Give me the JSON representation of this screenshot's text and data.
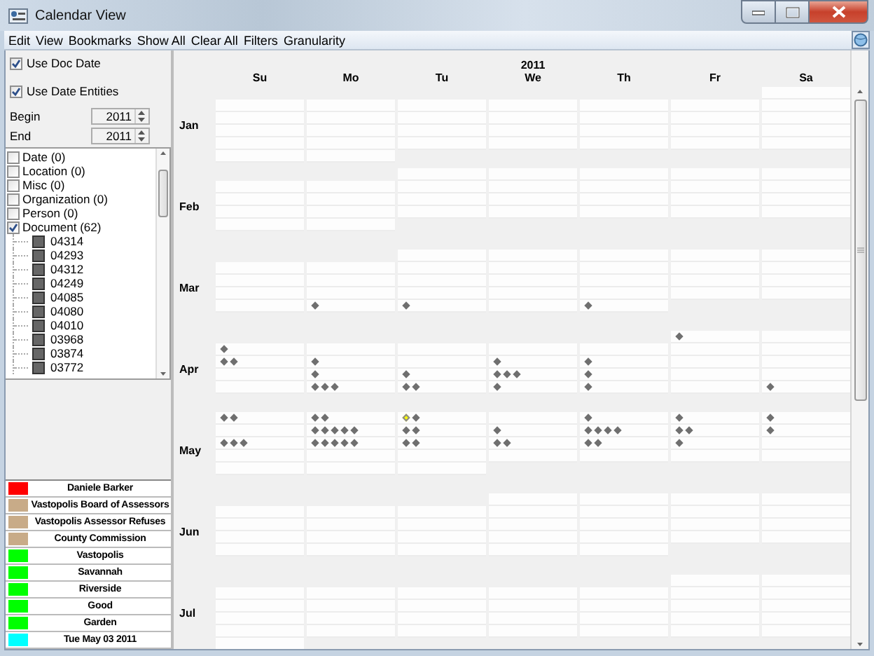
{
  "window": {
    "title": "Calendar View"
  },
  "menu": [
    "Edit",
    "View",
    "Bookmarks",
    "Show All",
    "Clear All",
    "Filters",
    "Granularity"
  ],
  "options": [
    {
      "label": "Use Doc Date",
      "checked": true
    },
    {
      "label": "Use Date Entities",
      "checked": true
    }
  ],
  "range": [
    {
      "label": "Begin",
      "value": "2011"
    },
    {
      "label": "End",
      "value": "2011"
    }
  ],
  "entity_tree": [
    {
      "label": "Date (0)",
      "checked": false
    },
    {
      "label": "Location (0)",
      "checked": false
    },
    {
      "label": "Misc (0)",
      "checked": false
    },
    {
      "label": "Organization (0)",
      "checked": false
    },
    {
      "label": "Person (0)",
      "checked": false
    },
    {
      "label": "Document (62)",
      "checked": true,
      "children": [
        {
          "label": "04314"
        },
        {
          "label": "04293"
        },
        {
          "label": "04312"
        },
        {
          "label": "04249"
        },
        {
          "label": "04085"
        },
        {
          "label": "04080"
        },
        {
          "label": "04010"
        },
        {
          "label": "03968"
        },
        {
          "label": "03874"
        },
        {
          "label": "03772"
        }
      ]
    }
  ],
  "legend": [
    {
      "label": "Daniele Barker",
      "color": "#ff0000"
    },
    {
      "label": "Vastopolis Board of Assessors",
      "color": "#c8ab88"
    },
    {
      "label": "Vastopolis Assessor Refuses",
      "color": "#c8ab88"
    },
    {
      "label": "County Commission",
      "color": "#c8ab88"
    },
    {
      "label": "Vastopolis",
      "color": "#00ff00"
    },
    {
      "label": "Savannah",
      "color": "#00ff00"
    },
    {
      "label": "Riverside",
      "color": "#00ff00"
    },
    {
      "label": "Good",
      "color": "#00ff00"
    },
    {
      "label": "Garden",
      "color": "#00ff00"
    },
    {
      "label": "Tue May 03 2011",
      "color": "#00ffff"
    }
  ],
  "calendar": {
    "year": "2011",
    "weekdays": [
      "Su",
      "Mo",
      "Tu",
      "We",
      "Th",
      "Fr",
      "Sa"
    ],
    "months": [
      {
        "label": "Jan",
        "weeks": [
          [
            {
              "kind": "blank"
            },
            {
              "kind": "blank"
            },
            {
              "kind": "blank"
            },
            {
              "kind": "blank"
            },
            {
              "kind": "blank"
            },
            {
              "kind": "blank"
            },
            {
              "kind": "day"
            }
          ],
          [
            {
              "kind": "day"
            },
            {
              "kind": "day"
            },
            {
              "kind": "day"
            },
            {
              "kind": "day"
            },
            {
              "kind": "day"
            },
            {
              "kind": "day"
            },
            {
              "kind": "day"
            }
          ],
          [
            {
              "kind": "day"
            },
            {
              "kind": "day"
            },
            {
              "kind": "day"
            },
            {
              "kind": "day"
            },
            {
              "kind": "day"
            },
            {
              "kind": "day"
            },
            {
              "kind": "day"
            }
          ],
          [
            {
              "kind": "day"
            },
            {
              "kind": "day"
            },
            {
              "kind": "day"
            },
            {
              "kind": "day"
            },
            {
              "kind": "day"
            },
            {
              "kind": "day"
            },
            {
              "kind": "day"
            }
          ],
          [
            {
              "kind": "day"
            },
            {
              "kind": "day"
            },
            {
              "kind": "day"
            },
            {
              "kind": "day"
            },
            {
              "kind": "day"
            },
            {
              "kind": "day"
            },
            {
              "kind": "day"
            }
          ],
          [
            {
              "kind": "day"
            },
            {
              "kind": "day"
            },
            {
              "kind": "blank"
            },
            {
              "kind": "blank"
            },
            {
              "kind": "blank"
            },
            {
              "kind": "blank"
            },
            {
              "kind": "blank"
            }
          ]
        ]
      },
      {
        "label": "Feb",
        "weeks": [
          [
            {
              "kind": "blank"
            },
            {
              "kind": "blank"
            },
            {
              "kind": "day"
            },
            {
              "kind": "day"
            },
            {
              "kind": "day"
            },
            {
              "kind": "day"
            },
            {
              "kind": "day"
            }
          ],
          [
            {
              "kind": "day"
            },
            {
              "kind": "day"
            },
            {
              "kind": "day"
            },
            {
              "kind": "day"
            },
            {
              "kind": "day"
            },
            {
              "kind": "day"
            },
            {
              "kind": "day"
            }
          ],
          [
            {
              "kind": "day"
            },
            {
              "kind": "day"
            },
            {
              "kind": "day"
            },
            {
              "kind": "day"
            },
            {
              "kind": "day"
            },
            {
              "kind": "day"
            },
            {
              "kind": "day"
            }
          ],
          [
            {
              "kind": "day"
            },
            {
              "kind": "day"
            },
            {
              "kind": "day"
            },
            {
              "kind": "day"
            },
            {
              "kind": "day"
            },
            {
              "kind": "day"
            },
            {
              "kind": "day"
            }
          ],
          [
            {
              "kind": "day"
            },
            {
              "kind": "day"
            },
            {
              "kind": "blank"
            },
            {
              "kind": "blank"
            },
            {
              "kind": "blank"
            },
            {
              "kind": "blank"
            },
            {
              "kind": "blank"
            }
          ]
        ]
      },
      {
        "label": "Mar",
        "weeks": [
          [
            {
              "kind": "blank"
            },
            {
              "kind": "blank"
            },
            {
              "kind": "day"
            },
            {
              "kind": "day"
            },
            {
              "kind": "day"
            },
            {
              "kind": "day"
            },
            {
              "kind": "day"
            }
          ],
          [
            {
              "kind": "day"
            },
            {
              "kind": "day"
            },
            {
              "kind": "day"
            },
            {
              "kind": "day"
            },
            {
              "kind": "day"
            },
            {
              "kind": "day"
            },
            {
              "kind": "day"
            }
          ],
          [
            {
              "kind": "day"
            },
            {
              "kind": "day"
            },
            {
              "kind": "day"
            },
            {
              "kind": "day"
            },
            {
              "kind": "day"
            },
            {
              "kind": "day"
            },
            {
              "kind": "day"
            }
          ],
          [
            {
              "kind": "day"
            },
            {
              "kind": "day"
            },
            {
              "kind": "day"
            },
            {
              "kind": "day"
            },
            {
              "kind": "day"
            },
            {
              "kind": "day"
            },
            {
              "kind": "day"
            }
          ],
          [
            {
              "kind": "day"
            },
            {
              "kind": "day",
              "events": [
                {
                  "selected": false
                }
              ]
            },
            {
              "kind": "day",
              "events": [
                {
                  "selected": false
                }
              ]
            },
            {
              "kind": "day"
            },
            {
              "kind": "day",
              "events": [
                {
                  "selected": false
                }
              ]
            },
            {
              "kind": "blank"
            },
            {
              "kind": "blank"
            }
          ]
        ]
      },
      {
        "label": "Apr",
        "weeks": [
          [
            {
              "kind": "blank"
            },
            {
              "kind": "blank"
            },
            {
              "kind": "blank"
            },
            {
              "kind": "blank"
            },
            {
              "kind": "blank"
            },
            {
              "kind": "day",
              "events": [
                {
                  "selected": false
                }
              ]
            },
            {
              "kind": "day"
            }
          ],
          [
            {
              "kind": "day",
              "events": [
                {
                  "selected": false
                }
              ]
            },
            {
              "kind": "day"
            },
            {
              "kind": "day"
            },
            {
              "kind": "day"
            },
            {
              "kind": "day"
            },
            {
              "kind": "day"
            },
            {
              "kind": "day"
            }
          ],
          [
            {
              "kind": "day",
              "events": [
                {
                  "selected": false
                },
                {
                  "selected": false
                }
              ]
            },
            {
              "kind": "day",
              "events": [
                {
                  "selected": false
                }
              ]
            },
            {
              "kind": "day"
            },
            {
              "kind": "day",
              "events": [
                {
                  "selected": false
                }
              ]
            },
            {
              "kind": "day",
              "events": [
                {
                  "selected": false
                }
              ]
            },
            {
              "kind": "day"
            },
            {
              "kind": "day"
            }
          ],
          [
            {
              "kind": "day"
            },
            {
              "kind": "day",
              "events": [
                {
                  "selected": false
                }
              ]
            },
            {
              "kind": "day",
              "events": [
                {
                  "selected": false
                }
              ]
            },
            {
              "kind": "day",
              "events": [
                {
                  "selected": false
                },
                {
                  "selected": false
                },
                {
                  "selected": false
                }
              ]
            },
            {
              "kind": "day",
              "events": [
                {
                  "selected": false
                }
              ]
            },
            {
              "kind": "day"
            },
            {
              "kind": "day"
            }
          ],
          [
            {
              "kind": "day"
            },
            {
              "kind": "day",
              "events": [
                {
                  "selected": false
                },
                {
                  "selected": false
                },
                {
                  "selected": false
                }
              ]
            },
            {
              "kind": "day",
              "events": [
                {
                  "selected": false
                },
                {
                  "selected": false
                }
              ]
            },
            {
              "kind": "day",
              "events": [
                {
                  "selected": false
                }
              ]
            },
            {
              "kind": "day",
              "events": [
                {
                  "selected": false
                }
              ]
            },
            {
              "kind": "day"
            },
            {
              "kind": "day",
              "events": [
                {
                  "selected": false
                }
              ]
            }
          ]
        ]
      },
      {
        "label": "May",
        "weeks": [
          [
            {
              "kind": "day",
              "events": [
                {
                  "selected": false
                },
                {
                  "selected": false
                }
              ]
            },
            {
              "kind": "day",
              "events": [
                {
                  "selected": false
                },
                {
                  "selected": false
                }
              ]
            },
            {
              "kind": "day",
              "events": [
                {
                  "selected": true
                },
                {
                  "selected": false
                }
              ]
            },
            {
              "kind": "day"
            },
            {
              "kind": "day",
              "events": [
                {
                  "selected": false
                }
              ]
            },
            {
              "kind": "day",
              "events": [
                {
                  "selected": false
                }
              ]
            },
            {
              "kind": "day",
              "events": [
                {
                  "selected": false
                }
              ]
            }
          ],
          [
            {
              "kind": "day"
            },
            {
              "kind": "day",
              "events": [
                {
                  "selected": false
                },
                {
                  "selected": false
                },
                {
                  "selected": false
                },
                {
                  "selected": false
                },
                {
                  "selected": false
                }
              ]
            },
            {
              "kind": "day",
              "events": [
                {
                  "selected": false
                },
                {
                  "selected": false
                }
              ]
            },
            {
              "kind": "day",
              "events": [
                {
                  "selected": false
                }
              ]
            },
            {
              "kind": "day",
              "events": [
                {
                  "selected": false
                },
                {
                  "selected": false
                },
                {
                  "selected": false
                },
                {
                  "selected": false
                }
              ]
            },
            {
              "kind": "day",
              "events": [
                {
                  "selected": false
                },
                {
                  "selected": false
                }
              ]
            },
            {
              "kind": "day",
              "events": [
                {
                  "selected": false
                }
              ]
            }
          ],
          [
            {
              "kind": "day",
              "events": [
                {
                  "selected": false
                },
                {
                  "selected": false
                },
                {
                  "selected": false
                }
              ]
            },
            {
              "kind": "day",
              "events": [
                {
                  "selected": false
                },
                {
                  "selected": false
                },
                {
                  "selected": false
                },
                {
                  "selected": false
                },
                {
                  "selected": false
                }
              ]
            },
            {
              "kind": "day",
              "events": [
                {
                  "selected": false
                },
                {
                  "selected": false
                }
              ]
            },
            {
              "kind": "day",
              "events": [
                {
                  "selected": false
                },
                {
                  "selected": false
                }
              ]
            },
            {
              "kind": "day",
              "events": [
                {
                  "selected": false
                },
                {
                  "selected": false
                }
              ]
            },
            {
              "kind": "day",
              "events": [
                {
                  "selected": false
                }
              ]
            },
            {
              "kind": "day"
            }
          ],
          [
            {
              "kind": "day"
            },
            {
              "kind": "day"
            },
            {
              "kind": "day"
            },
            {
              "kind": "day"
            },
            {
              "kind": "day"
            },
            {
              "kind": "day"
            },
            {
              "kind": "day"
            }
          ],
          [
            {
              "kind": "day"
            },
            {
              "kind": "day"
            },
            {
              "kind": "day"
            },
            {
              "kind": "blank"
            },
            {
              "kind": "blank"
            },
            {
              "kind": "blank"
            },
            {
              "kind": "blank"
            }
          ]
        ]
      },
      {
        "label": "Jun",
        "weeks": [
          [
            {
              "kind": "blank"
            },
            {
              "kind": "blank"
            },
            {
              "kind": "blank"
            },
            {
              "kind": "day"
            },
            {
              "kind": "day"
            },
            {
              "kind": "day"
            },
            {
              "kind": "day"
            }
          ],
          [
            {
              "kind": "day"
            },
            {
              "kind": "day"
            },
            {
              "kind": "day"
            },
            {
              "kind": "day"
            },
            {
              "kind": "day"
            },
            {
              "kind": "day"
            },
            {
              "kind": "day"
            }
          ],
          [
            {
              "kind": "day"
            },
            {
              "kind": "day"
            },
            {
              "kind": "day"
            },
            {
              "kind": "day"
            },
            {
              "kind": "day"
            },
            {
              "kind": "day"
            },
            {
              "kind": "day"
            }
          ],
          [
            {
              "kind": "day"
            },
            {
              "kind": "day"
            },
            {
              "kind": "day"
            },
            {
              "kind": "day"
            },
            {
              "kind": "day"
            },
            {
              "kind": "day"
            },
            {
              "kind": "day"
            }
          ],
          [
            {
              "kind": "day"
            },
            {
              "kind": "day"
            },
            {
              "kind": "day"
            },
            {
              "kind": "day"
            },
            {
              "kind": "day"
            },
            {
              "kind": "blank"
            },
            {
              "kind": "blank"
            }
          ]
        ]
      },
      {
        "label": "Jul",
        "weeks": [
          [
            {
              "kind": "blank"
            },
            {
              "kind": "blank"
            },
            {
              "kind": "blank"
            },
            {
              "kind": "blank"
            },
            {
              "kind": "blank"
            },
            {
              "kind": "day"
            },
            {
              "kind": "day"
            }
          ],
          [
            {
              "kind": "day"
            },
            {
              "kind": "day"
            },
            {
              "kind": "day"
            },
            {
              "kind": "day"
            },
            {
              "kind": "day"
            },
            {
              "kind": "day"
            },
            {
              "kind": "day"
            }
          ],
          [
            {
              "kind": "day"
            },
            {
              "kind": "day"
            },
            {
              "kind": "day"
            },
            {
              "kind": "day"
            },
            {
              "kind": "day"
            },
            {
              "kind": "day"
            },
            {
              "kind": "day"
            }
          ],
          [
            {
              "kind": "day"
            },
            {
              "kind": "day"
            },
            {
              "kind": "day"
            },
            {
              "kind": "day"
            },
            {
              "kind": "day"
            },
            {
              "kind": "day"
            },
            {
              "kind": "day"
            }
          ],
          [
            {
              "kind": "day"
            },
            {
              "kind": "day"
            },
            {
              "kind": "day"
            },
            {
              "kind": "day"
            },
            {
              "kind": "day"
            },
            {
              "kind": "day"
            },
            {
              "kind": "day"
            }
          ],
          [
            {
              "kind": "day"
            },
            {
              "kind": "blank"
            },
            {
              "kind": "blank"
            },
            {
              "kind": "blank"
            },
            {
              "kind": "blank"
            },
            {
              "kind": "blank"
            },
            {
              "kind": "blank"
            }
          ]
        ]
      }
    ]
  }
}
